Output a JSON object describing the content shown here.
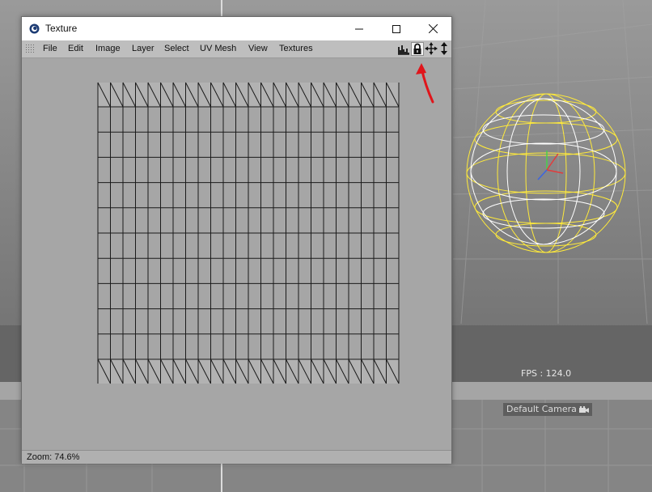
{
  "window": {
    "title": "Texture",
    "controls": [
      "minimize",
      "maximize",
      "close"
    ]
  },
  "menubar": {
    "items": [
      "File",
      "Edit",
      "Image",
      "Layer",
      "Select",
      "UV Mesh",
      "View",
      "Textures"
    ]
  },
  "toolbar_icons": [
    "histogram-icon",
    "lock-icon",
    "move-icon",
    "scroll-icon"
  ],
  "statusbar": {
    "zoom": "Zoom: 74.6%"
  },
  "viewport": {
    "fps": "FPS : 124.0",
    "camera": "Default Camera"
  },
  "colors": {
    "annotation_arrow": "#e0151b",
    "uv_lines": "#1a1a1a",
    "sphere_selected": "#ffea3a",
    "sphere_wire": "#ffffff"
  }
}
